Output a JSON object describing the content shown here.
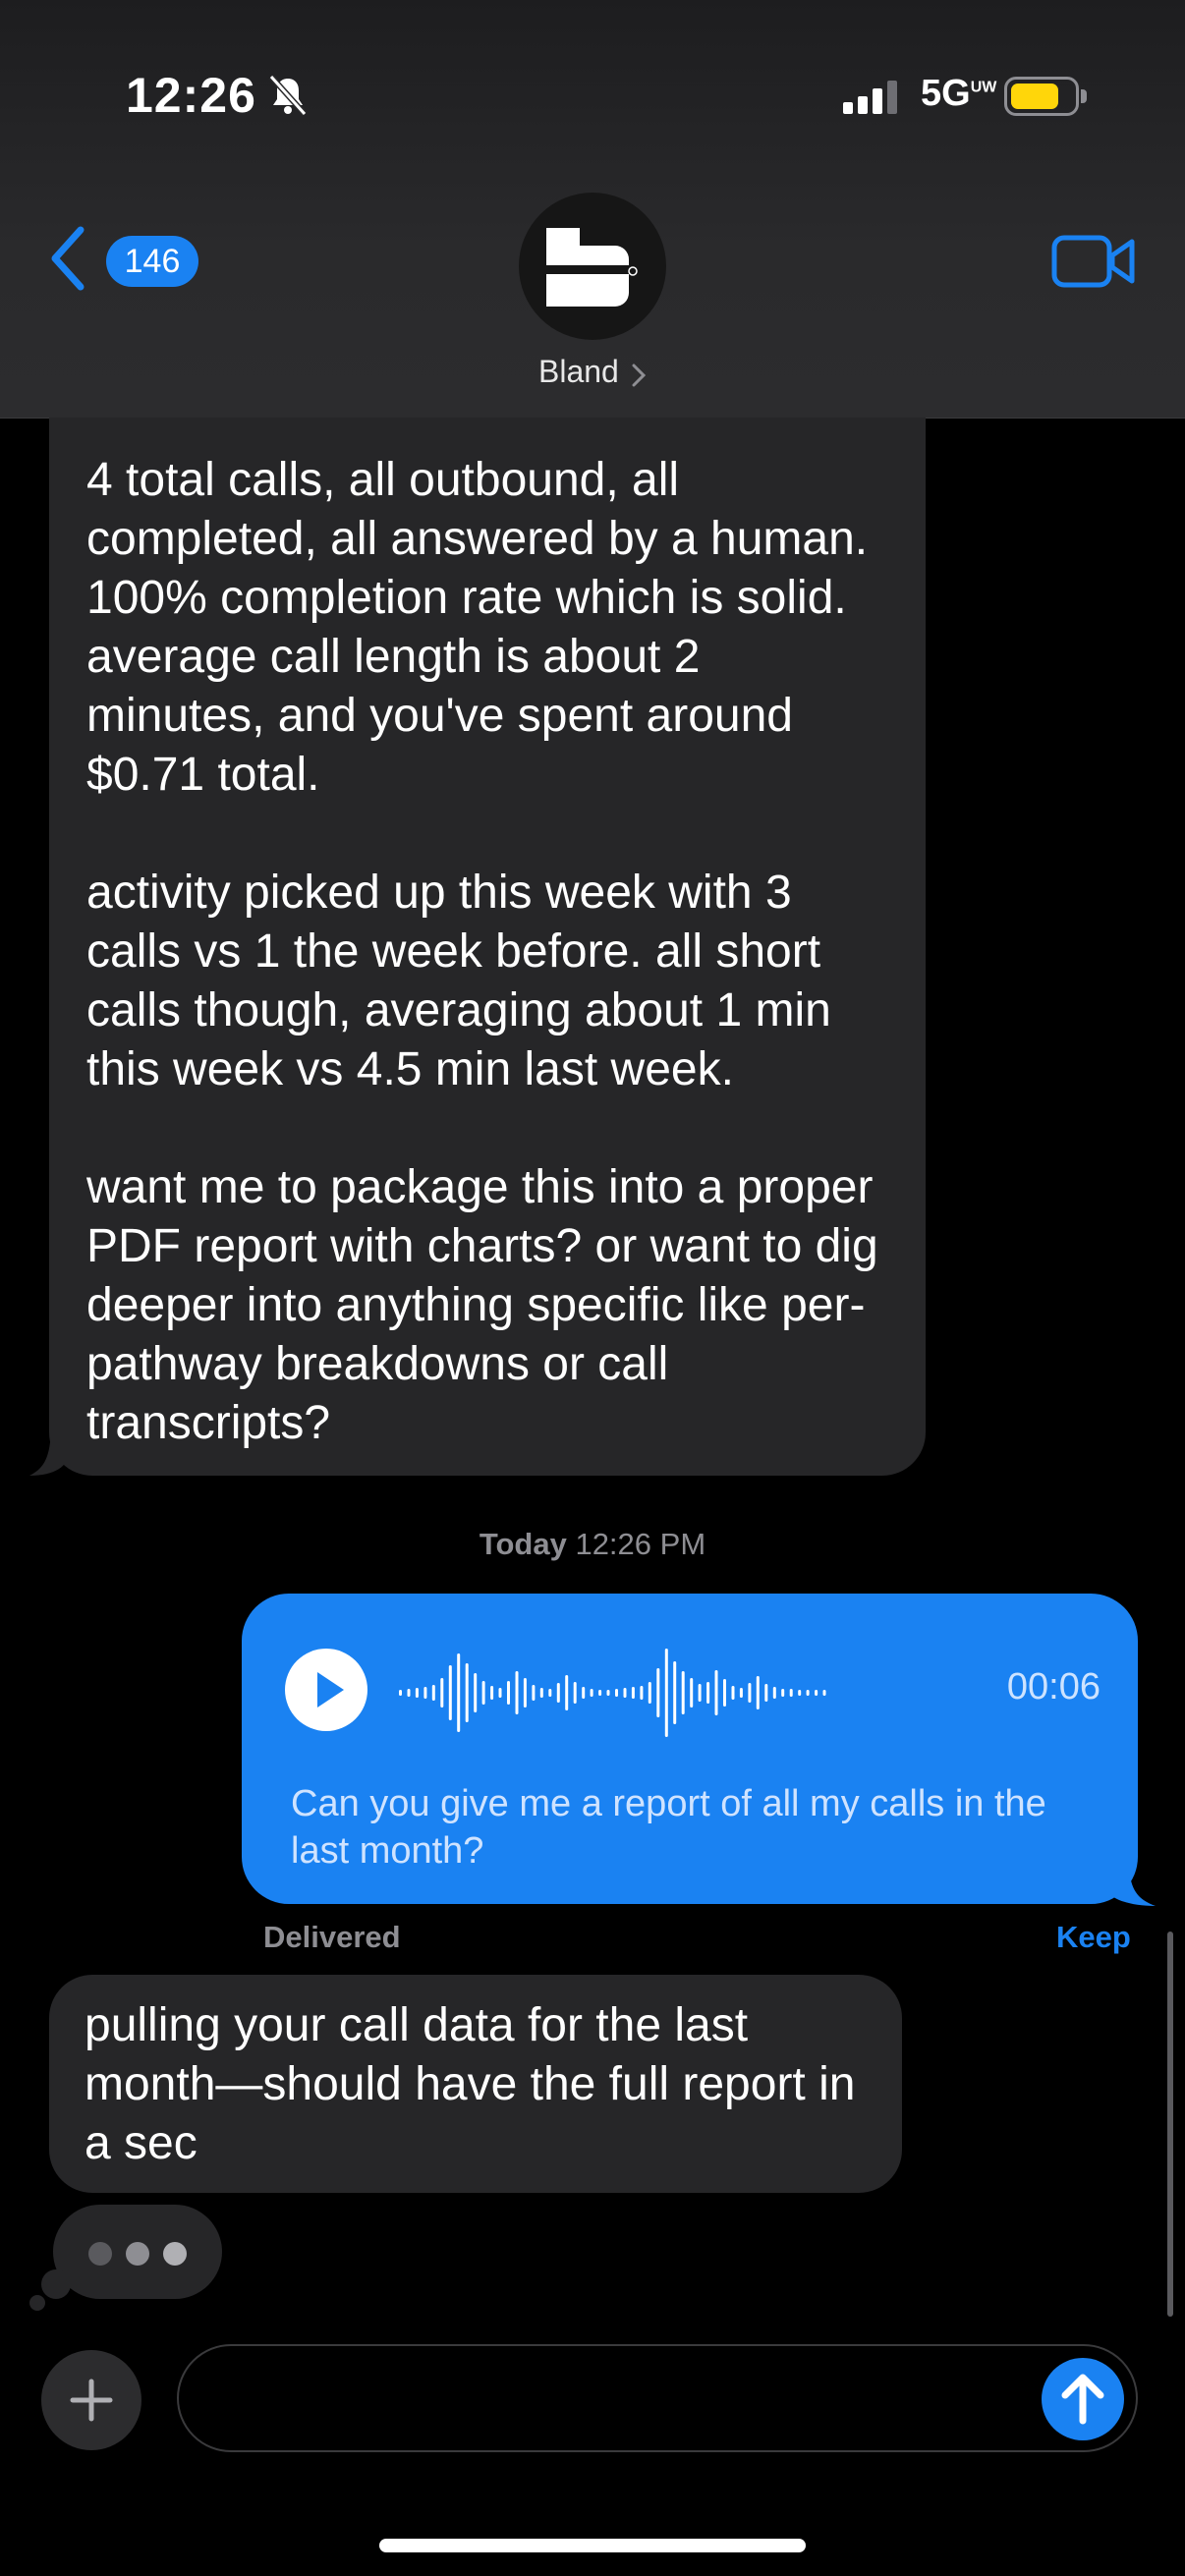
{
  "status_bar": {
    "time": "12:26",
    "network": "5G",
    "network_suffix": "UW"
  },
  "nav": {
    "back_count": "146",
    "contact_name": "Bland"
  },
  "messages": {
    "summary_paragraphs": [
      "4 total calls, all outbound, all completed, all answered by a human. 100% completion rate which is solid. average call length is about 2 minutes, and you've spent around $0.71 total.",
      "activity picked up this week with 3 calls vs 1 the week before. all short calls though, averaging about 1 min this week vs 4.5 min last week.",
      "want me to package this into a proper PDF report with charts? or want to dig deeper into anything specific like per-pathway breakdowns or call transcripts?"
    ],
    "timestamp_day": "Today",
    "timestamp_time": "12:26 PM",
    "voice_message": {
      "duration": "00:06",
      "transcript": "Can you give me a report of all my calls in the last month?"
    },
    "delivered_label": "Delivered",
    "keep_label": "Keep",
    "reply": "pulling your call data for the last month—should have the full report in a sec"
  },
  "colors": {
    "accent": "#1a82f2",
    "incoming_bubble": "#262628",
    "battery": "#ffd60a"
  }
}
